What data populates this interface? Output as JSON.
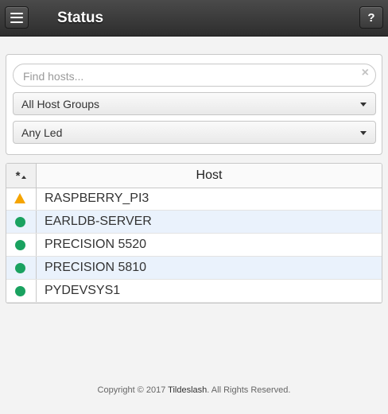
{
  "header": {
    "title": "Status",
    "help_label": "?"
  },
  "filters": {
    "search_placeholder": "Find hosts...",
    "clear_symbol": "×",
    "host_group": "All Host Groups",
    "led": "Any Led"
  },
  "table": {
    "led_header": "*",
    "host_header": "Host",
    "rows": [
      {
        "status": "warning",
        "host": "RASPBERRY_PI3"
      },
      {
        "status": "ok",
        "host": "EARLDB-SERVER"
      },
      {
        "status": "ok",
        "host": "PRECISION 5520"
      },
      {
        "status": "ok",
        "host": "PRECISION 5810"
      },
      {
        "status": "ok",
        "host": "PYDEVSYS1"
      }
    ]
  },
  "footer": {
    "prefix": "Copyright © 2017 ",
    "brand": "Tildeslash",
    "suffix": ". All Rights Reserved."
  },
  "colors": {
    "ok": "#1aa260",
    "warning": "#f5a400",
    "row_alt": "#eaf2fc"
  }
}
